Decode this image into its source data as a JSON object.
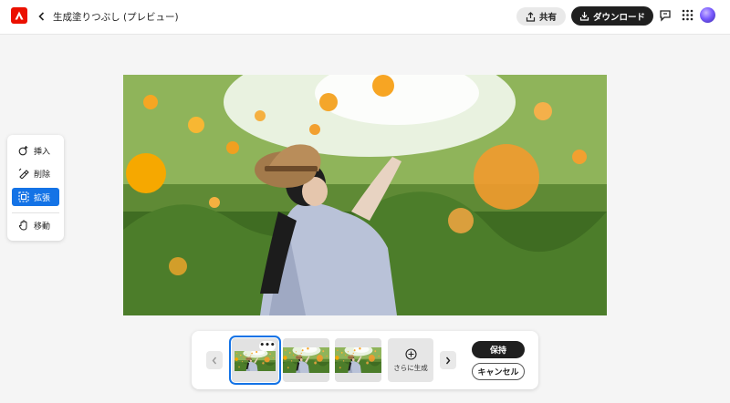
{
  "header": {
    "title": "生成塗りつぶし (プレビュー)",
    "share_label": "共有",
    "download_label": "ダウンロード",
    "icons": [
      "adobe-logo",
      "chevron-left-icon",
      "share-icon",
      "download-icon",
      "comment-icon",
      "apps-grid-icon",
      "avatar"
    ]
  },
  "tools": {
    "items": [
      {
        "label": "挿入",
        "icon": "insert-icon",
        "active": false
      },
      {
        "label": "削除",
        "icon": "remove-icon",
        "active": false
      },
      {
        "label": "拡張",
        "icon": "expand-icon",
        "active": true
      },
      {
        "label": "移動",
        "icon": "hand-icon",
        "active": false
      }
    ]
  },
  "variations": {
    "more_label": "•••",
    "generate_more_label": "さらに生成",
    "selected_index": 0,
    "count": 3
  },
  "actions": {
    "keep_label": "保持",
    "cancel_label": "キャンセル"
  },
  "colors": {
    "accent": "#1473e6",
    "brand": "#eb1000",
    "dark_button": "#1f1f1f"
  }
}
